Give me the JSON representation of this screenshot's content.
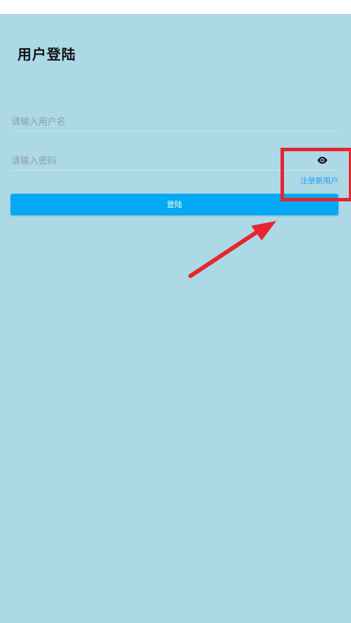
{
  "header": {
    "title": "用户登陆"
  },
  "form": {
    "username_placeholder": "请输入用户名",
    "password_placeholder": "请输入密码",
    "register_link": "注册新用户",
    "login_button": "登陆"
  },
  "icons": {
    "password_toggle": "eye-icon"
  },
  "colors": {
    "background": "#add8e6",
    "primary_button": "#03a9f4",
    "link": "#1aa0f0",
    "annotation": "#e5262f"
  }
}
